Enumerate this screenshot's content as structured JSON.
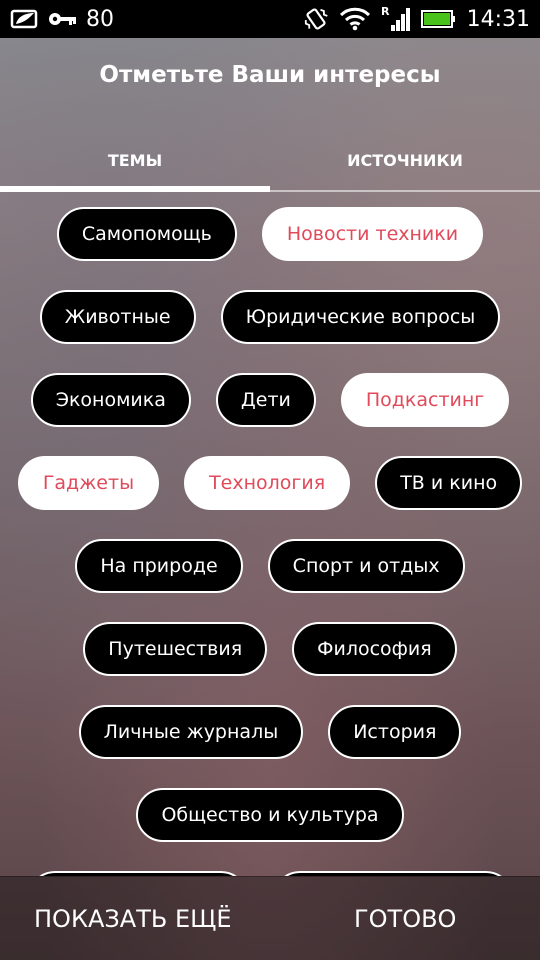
{
  "status_bar": {
    "battery_level": "80",
    "time": "14:31",
    "roaming_indicator": "R",
    "icons": [
      "photo-leaf-icon",
      "key-icon",
      "vibrate-icon",
      "wifi-icon",
      "signal-icon",
      "battery-icon"
    ],
    "battery_color": "#49c21b"
  },
  "header": {
    "title": "Отметьте Ваши интересы"
  },
  "tabs": [
    {
      "label": "ТЕМЫ",
      "selected": true
    },
    {
      "label": "ИСТОЧНИКИ",
      "selected": false
    }
  ],
  "topics": {
    "rows": [
      [
        {
          "label": "Самопомощь",
          "selected": false
        },
        {
          "label": "Новости техники",
          "selected": true
        }
      ],
      [
        {
          "label": "Животные",
          "selected": false
        },
        {
          "label": "Юридические вопросы",
          "selected": false
        }
      ],
      [
        {
          "label": "Экономика",
          "selected": false
        },
        {
          "label": "Дети",
          "selected": false
        },
        {
          "label": "Подкастинг",
          "selected": true
        }
      ],
      [
        {
          "label": "Гаджеты",
          "selected": true
        },
        {
          "label": "Технология",
          "selected": true
        },
        {
          "label": "ТВ и кино",
          "selected": false
        }
      ],
      [
        {
          "label": "На природе",
          "selected": false
        },
        {
          "label": "Спорт и отдых",
          "selected": false
        }
      ],
      [
        {
          "label": "Путешествия",
          "selected": false
        },
        {
          "label": "Философия",
          "selected": false
        }
      ],
      [
        {
          "label": "Личные журналы",
          "selected": false
        },
        {
          "label": "История",
          "selected": false
        }
      ],
      [
        {
          "label": "Общество и культура",
          "selected": false
        }
      ]
    ],
    "selected_text_color": "#e04a5a"
  },
  "bottom_bar": {
    "show_more_label": "ПОКАЗАТЬ ЕЩЁ",
    "done_label": "ГОТОВО"
  }
}
